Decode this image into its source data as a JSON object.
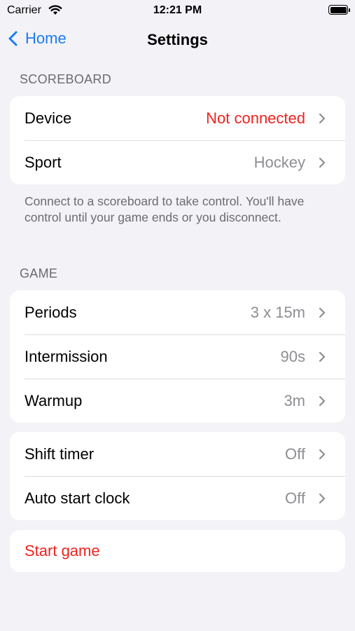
{
  "status_bar": {
    "carrier": "Carrier",
    "time": "12:21 PM"
  },
  "nav": {
    "back_label": "Home",
    "title": "Settings"
  },
  "scoreboard": {
    "header": "SCOREBOARD",
    "rows": [
      {
        "label": "Device",
        "value": "Not connected"
      },
      {
        "label": "Sport",
        "value": "Hockey"
      }
    ],
    "footer": "Connect to a scoreboard to take control.  You'll have control until your game ends or you disconnect."
  },
  "game": {
    "header": "GAME",
    "rows": [
      {
        "label": "Periods",
        "value": "3 x 15m"
      },
      {
        "label": "Intermission",
        "value": "90s"
      },
      {
        "label": "Warmup",
        "value": "3m"
      }
    ]
  },
  "options": {
    "rows": [
      {
        "label": "Shift timer",
        "value": "Off"
      },
      {
        "label": "Auto start clock",
        "value": "Off"
      }
    ]
  },
  "actions": {
    "start_game": "Start game"
  },
  "colors": {
    "accent": "#1a7cf2",
    "danger": "#ee2320",
    "secondary_text": "#8e8e93",
    "background": "#f2f2f7"
  }
}
